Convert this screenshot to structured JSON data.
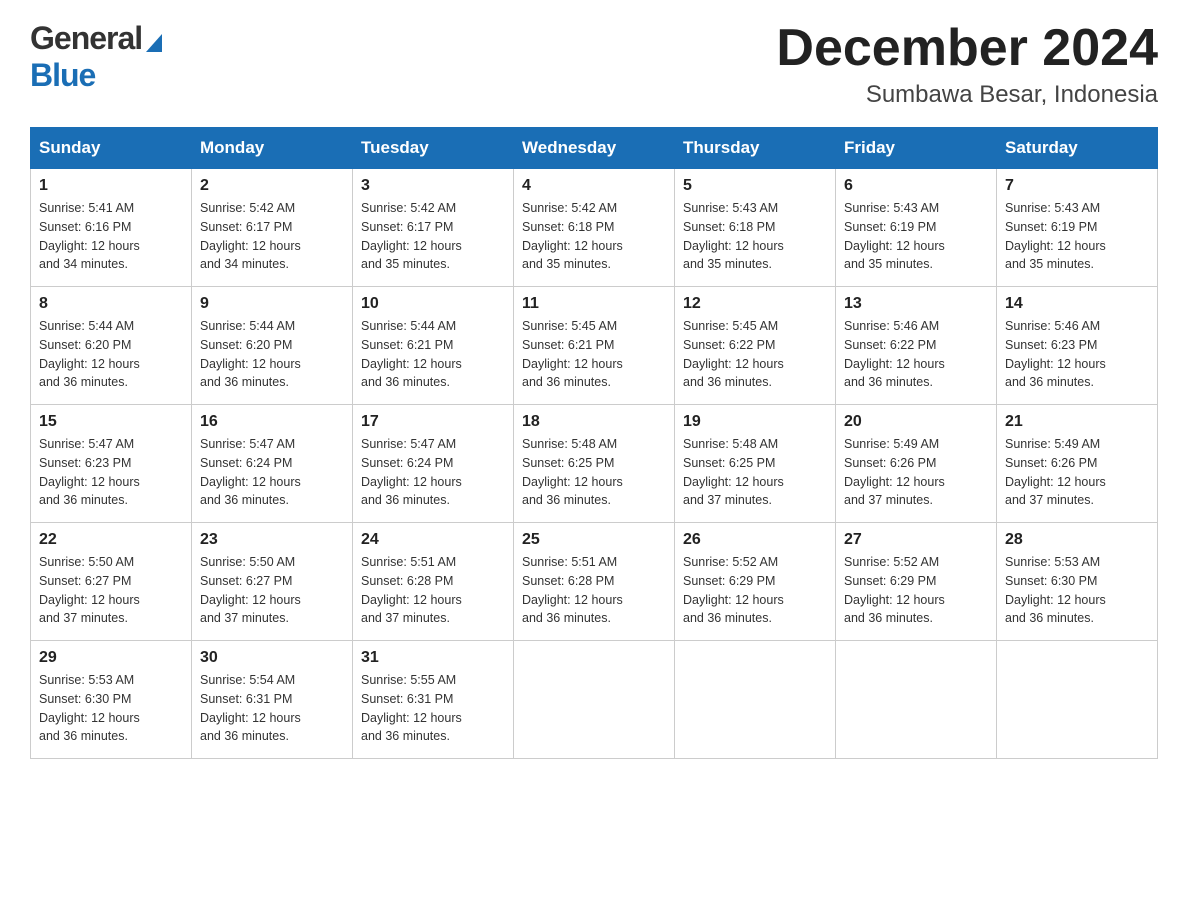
{
  "header": {
    "logo_general": "General",
    "logo_blue": "Blue",
    "month_title": "December 2024",
    "location": "Sumbawa Besar, Indonesia"
  },
  "weekdays": [
    "Sunday",
    "Monday",
    "Tuesday",
    "Wednesday",
    "Thursday",
    "Friday",
    "Saturday"
  ],
  "weeks": [
    [
      {
        "day": "1",
        "sunrise": "5:41 AM",
        "sunset": "6:16 PM",
        "daylight": "12 hours and 34 minutes."
      },
      {
        "day": "2",
        "sunrise": "5:42 AM",
        "sunset": "6:17 PM",
        "daylight": "12 hours and 34 minutes."
      },
      {
        "day": "3",
        "sunrise": "5:42 AM",
        "sunset": "6:17 PM",
        "daylight": "12 hours and 35 minutes."
      },
      {
        "day": "4",
        "sunrise": "5:42 AM",
        "sunset": "6:18 PM",
        "daylight": "12 hours and 35 minutes."
      },
      {
        "day": "5",
        "sunrise": "5:43 AM",
        "sunset": "6:18 PM",
        "daylight": "12 hours and 35 minutes."
      },
      {
        "day": "6",
        "sunrise": "5:43 AM",
        "sunset": "6:19 PM",
        "daylight": "12 hours and 35 minutes."
      },
      {
        "day": "7",
        "sunrise": "5:43 AM",
        "sunset": "6:19 PM",
        "daylight": "12 hours and 35 minutes."
      }
    ],
    [
      {
        "day": "8",
        "sunrise": "5:44 AM",
        "sunset": "6:20 PM",
        "daylight": "12 hours and 36 minutes."
      },
      {
        "day": "9",
        "sunrise": "5:44 AM",
        "sunset": "6:20 PM",
        "daylight": "12 hours and 36 minutes."
      },
      {
        "day": "10",
        "sunrise": "5:44 AM",
        "sunset": "6:21 PM",
        "daylight": "12 hours and 36 minutes."
      },
      {
        "day": "11",
        "sunrise": "5:45 AM",
        "sunset": "6:21 PM",
        "daylight": "12 hours and 36 minutes."
      },
      {
        "day": "12",
        "sunrise": "5:45 AM",
        "sunset": "6:22 PM",
        "daylight": "12 hours and 36 minutes."
      },
      {
        "day": "13",
        "sunrise": "5:46 AM",
        "sunset": "6:22 PM",
        "daylight": "12 hours and 36 minutes."
      },
      {
        "day": "14",
        "sunrise": "5:46 AM",
        "sunset": "6:23 PM",
        "daylight": "12 hours and 36 minutes."
      }
    ],
    [
      {
        "day": "15",
        "sunrise": "5:47 AM",
        "sunset": "6:23 PM",
        "daylight": "12 hours and 36 minutes."
      },
      {
        "day": "16",
        "sunrise": "5:47 AM",
        "sunset": "6:24 PM",
        "daylight": "12 hours and 36 minutes."
      },
      {
        "day": "17",
        "sunrise": "5:47 AM",
        "sunset": "6:24 PM",
        "daylight": "12 hours and 36 minutes."
      },
      {
        "day": "18",
        "sunrise": "5:48 AM",
        "sunset": "6:25 PM",
        "daylight": "12 hours and 36 minutes."
      },
      {
        "day": "19",
        "sunrise": "5:48 AM",
        "sunset": "6:25 PM",
        "daylight": "12 hours and 37 minutes."
      },
      {
        "day": "20",
        "sunrise": "5:49 AM",
        "sunset": "6:26 PM",
        "daylight": "12 hours and 37 minutes."
      },
      {
        "day": "21",
        "sunrise": "5:49 AM",
        "sunset": "6:26 PM",
        "daylight": "12 hours and 37 minutes."
      }
    ],
    [
      {
        "day": "22",
        "sunrise": "5:50 AM",
        "sunset": "6:27 PM",
        "daylight": "12 hours and 37 minutes."
      },
      {
        "day": "23",
        "sunrise": "5:50 AM",
        "sunset": "6:27 PM",
        "daylight": "12 hours and 37 minutes."
      },
      {
        "day": "24",
        "sunrise": "5:51 AM",
        "sunset": "6:28 PM",
        "daylight": "12 hours and 37 minutes."
      },
      {
        "day": "25",
        "sunrise": "5:51 AM",
        "sunset": "6:28 PM",
        "daylight": "12 hours and 36 minutes."
      },
      {
        "day": "26",
        "sunrise": "5:52 AM",
        "sunset": "6:29 PM",
        "daylight": "12 hours and 36 minutes."
      },
      {
        "day": "27",
        "sunrise": "5:52 AM",
        "sunset": "6:29 PM",
        "daylight": "12 hours and 36 minutes."
      },
      {
        "day": "28",
        "sunrise": "5:53 AM",
        "sunset": "6:30 PM",
        "daylight": "12 hours and 36 minutes."
      }
    ],
    [
      {
        "day": "29",
        "sunrise": "5:53 AM",
        "sunset": "6:30 PM",
        "daylight": "12 hours and 36 minutes."
      },
      {
        "day": "30",
        "sunrise": "5:54 AM",
        "sunset": "6:31 PM",
        "daylight": "12 hours and 36 minutes."
      },
      {
        "day": "31",
        "sunrise": "5:55 AM",
        "sunset": "6:31 PM",
        "daylight": "12 hours and 36 minutes."
      },
      null,
      null,
      null,
      null
    ]
  ],
  "labels": {
    "sunrise": "Sunrise:",
    "sunset": "Sunset:",
    "daylight": "Daylight:"
  }
}
